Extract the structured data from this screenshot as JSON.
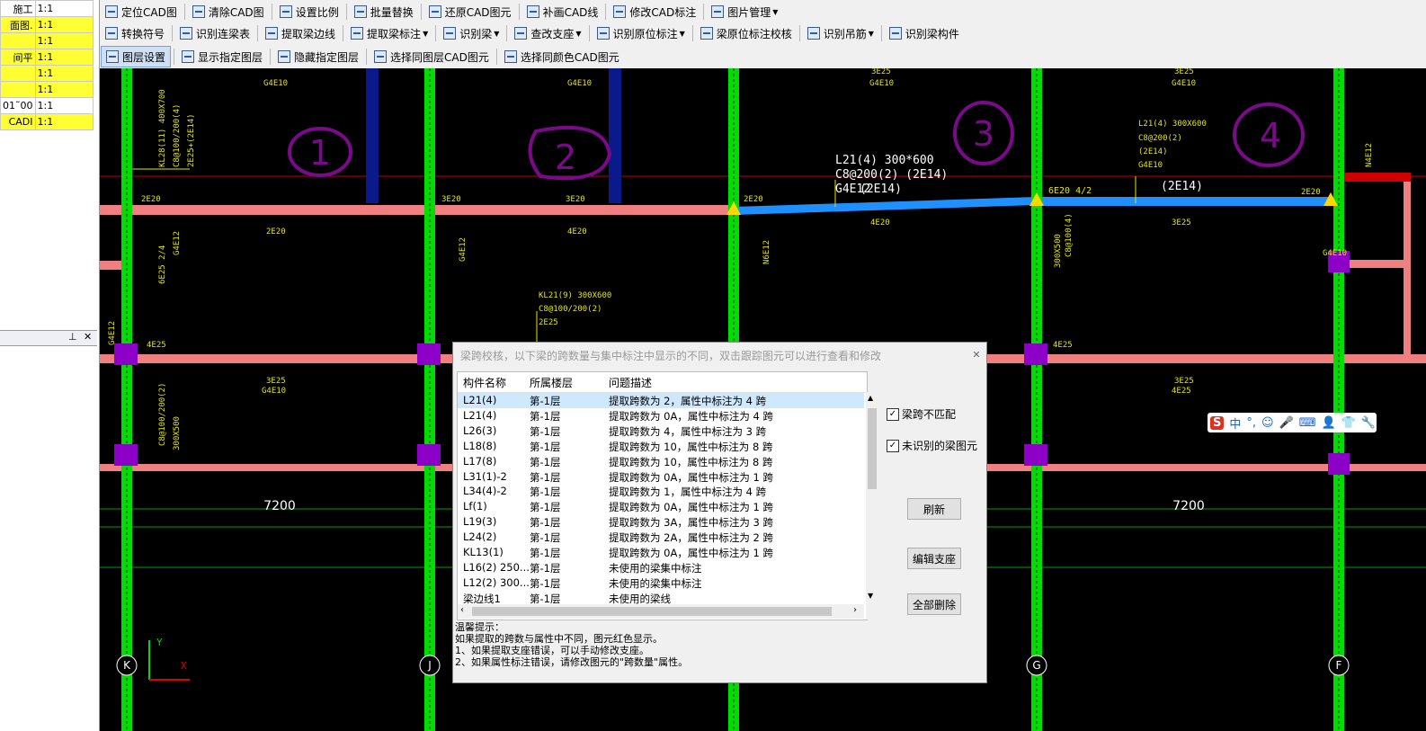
{
  "toolbar1": [
    {
      "label": "定位CAD图",
      "dd": false
    },
    {
      "label": "清除CAD图",
      "dd": false
    },
    {
      "label": "设置比例",
      "dd": false
    },
    {
      "label": "批量替换",
      "dd": false
    },
    {
      "label": "还原CAD图元",
      "dd": false
    },
    {
      "label": "补画CAD线",
      "dd": false
    },
    {
      "label": "修改CAD标注",
      "dd": false
    },
    {
      "label": "图片管理",
      "dd": true
    }
  ],
  "toolbar2": [
    {
      "label": "转换符号",
      "dd": false
    },
    {
      "label": "识别连梁表",
      "dd": false
    },
    {
      "label": "提取梁边线",
      "dd": false
    },
    {
      "label": "提取梁标注",
      "dd": true
    },
    {
      "label": "识别梁",
      "dd": true
    },
    {
      "label": "查改支座",
      "dd": true
    },
    {
      "label": "识别原位标注",
      "dd": true
    },
    {
      "label": "梁原位标注校核",
      "dd": false
    },
    {
      "label": "识别吊筋",
      "dd": true
    },
    {
      "label": "识别梁构件",
      "dd": false
    }
  ],
  "toolbar3": [
    {
      "label": "图层设置",
      "dd": false
    },
    {
      "label": "显示指定图层",
      "dd": false
    },
    {
      "label": "隐藏指定图层",
      "dd": false
    },
    {
      "label": "选择同图层CAD图元",
      "dd": false
    },
    {
      "label": "选择同颜色CAD图元",
      "dd": false
    }
  ],
  "layer_table": [
    {
      "name": "施工",
      "scale": "1:1",
      "hl": false
    },
    {
      "name": "面图.",
      "scale": "1:1",
      "hl": true
    },
    {
      "name": "",
      "scale": "1:1",
      "hl": true
    },
    {
      "name": "间平",
      "scale": "1:1",
      "hl": true
    },
    {
      "name": "",
      "scale": "1:1",
      "hl": true
    },
    {
      "name": "",
      "scale": "1:1",
      "hl": true
    },
    {
      "name": "01˜00",
      "scale": "1:1",
      "hl": false
    },
    {
      "name": "CADI",
      "scale": "1:1",
      "hl": true
    }
  ],
  "left_lower_header": {
    "pin": "⊥",
    "close": "✕"
  },
  "canvas": {
    "circled_numbers": [
      "1",
      "2",
      "3",
      "4"
    ],
    "dims": [
      "7200",
      "7200"
    ],
    "axes": [
      "K",
      "J",
      "G",
      "F"
    ],
    "axis_y": "Y",
    "axis_x": "X",
    "annot_big": [
      "L21(4)  300*600",
      "C8@200(2)  (2E14)",
      "G4E12",
      "(2E14)",
      "6E20 4/2",
      "(2E14)"
    ],
    "annot_small": [
      "L21(4)  300X600",
      "C8@200(2)",
      "(2E14)",
      "G4E10",
      "KL21(9)  300X600",
      "C8@100/200(2)",
      "2E25",
      "KL28(11)  400X700",
      "C8@100/200(4)",
      "2E25+(2E14)",
      "2E20",
      "3E20",
      "3E20",
      "2E20",
      "2E20",
      "2E20",
      "4E20",
      "4E20",
      "3E25",
      "3E25",
      "3E25",
      "3E25",
      "3E25",
      "G4E10",
      "G4E10",
      "G4E10",
      "G4E10",
      "G4E10",
      "G4E10",
      "4E25",
      "4E25",
      "4E25",
      "G4E12",
      "N4E12",
      "N6E12",
      "G4E12",
      "G4E12",
      "C8@100(4)",
      "6E25 2/4",
      "300X500",
      "C8@100/200(2)",
      "300X500"
    ]
  },
  "dialog": {
    "title": "梁跨校核，以下梁的跨数量与集中标注中显示的不同，双击跟踪图元可以进行查看和修改",
    "close": "✕",
    "columns": [
      "构件名称",
      "所属楼层",
      "问题描述"
    ],
    "rows": [
      {
        "name": "L21(4)",
        "floor": "第-1层",
        "desc": "提取跨数为 2，属性中标注为 4 跨",
        "sel": true
      },
      {
        "name": "L21(4)",
        "floor": "第-1层",
        "desc": "提取跨数为 0A，属性中标注为 4 跨",
        "sel": false
      },
      {
        "name": "L26(3)",
        "floor": "第-1层",
        "desc": "提取跨数为 4，属性中标注为 3 跨",
        "sel": false
      },
      {
        "name": "L18(8)",
        "floor": "第-1层",
        "desc": "提取跨数为 10，属性中标注为 8 跨",
        "sel": false
      },
      {
        "name": "L17(8)",
        "floor": "第-1层",
        "desc": "提取跨数为 10，属性中标注为 8 跨",
        "sel": false
      },
      {
        "name": "L31(1)-2",
        "floor": "第-1层",
        "desc": "提取跨数为 0A，属性中标注为 1 跨",
        "sel": false
      },
      {
        "name": "L34(4)-2",
        "floor": "第-1层",
        "desc": "提取跨数为 1，属性中标注为 4 跨",
        "sel": false
      },
      {
        "name": "Lf(1)",
        "floor": "第-1层",
        "desc": "提取跨数为 0A，属性中标注为 1 跨",
        "sel": false
      },
      {
        "name": "L19(3)",
        "floor": "第-1层",
        "desc": "提取跨数为 3A，属性中标注为 3 跨",
        "sel": false
      },
      {
        "name": "L24(2)",
        "floor": "第-1层",
        "desc": "提取跨数为 2A，属性中标注为 2 跨",
        "sel": false
      },
      {
        "name": "KL13(1)",
        "floor": "第-1层",
        "desc": "提取跨数为 0A，属性中标注为 1 跨",
        "sel": false
      },
      {
        "name": "L16(2) 250...",
        "floor": "第-1层",
        "desc": "未使用的梁集中标注",
        "sel": false
      },
      {
        "name": "L12(2) 300...",
        "floor": "第-1层",
        "desc": "未使用的梁集中标注",
        "sel": false
      },
      {
        "name": "梁边线1",
        "floor": "第-1层",
        "desc": "未使用的梁线",
        "sel": false
      }
    ],
    "check_span_label": "梁跨不匹配",
    "check_span": true,
    "check_unrec_label": "未识别的梁图元",
    "check_unrec": true,
    "btn_refresh": "刷新",
    "btn_edit_support": "编辑支座",
    "btn_delete_all": "全部删除",
    "tips": [
      "温馨提示：",
      "如果提取的跨数与属性中不同，图元红色显示。",
      "1、如果提取支座错误，可以手动修改支座。",
      "2、如果属性标注错误，请修改图元的\"跨数量\"属性。"
    ]
  },
  "ime": {
    "logo": "S",
    "items": [
      "中",
      "°,",
      "☺",
      "🎤",
      "⌨",
      "👤",
      "👕",
      "🔧"
    ]
  },
  "colors": {
    "canvas_bg": "#000000",
    "column_green": "#00dd00",
    "beam_pink": "#f08080",
    "beam_blue": "#1e90ff",
    "annot_yellow": "#e6e600",
    "marker_purple": "#8c00c8",
    "grid_green": "#00a000"
  }
}
